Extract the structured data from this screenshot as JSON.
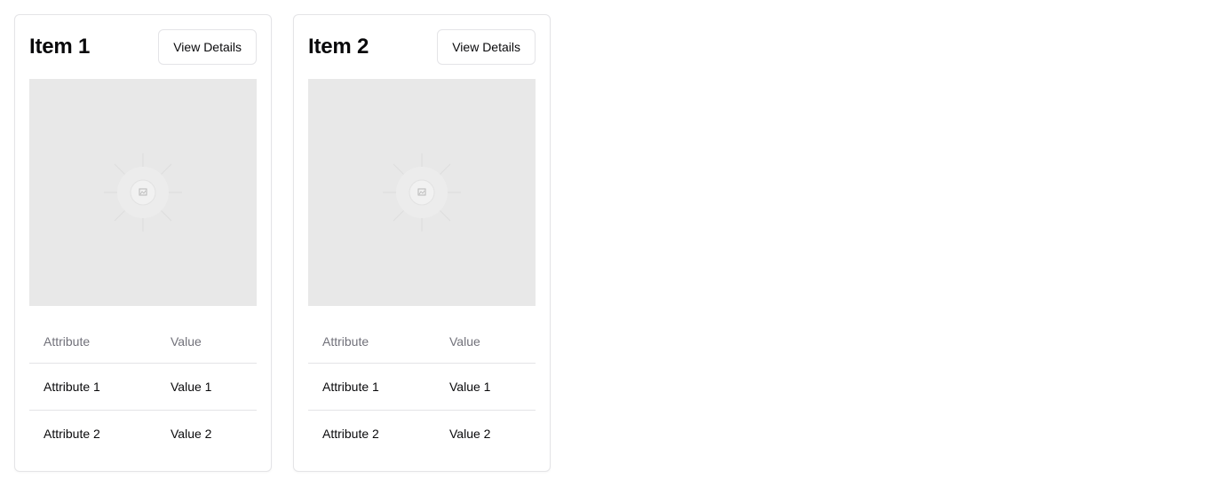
{
  "items": [
    {
      "title": "Item 1",
      "button_label": "View Details",
      "image_icon": "image-placeholder-icon",
      "table": {
        "headers": [
          "Attribute",
          "Value"
        ],
        "rows": [
          [
            "Attribute 1",
            "Value 1"
          ],
          [
            "Attribute 2",
            "Value 2"
          ]
        ]
      }
    },
    {
      "title": "Item 2",
      "button_label": "View Details",
      "image_icon": "image-placeholder-icon",
      "table": {
        "headers": [
          "Attribute",
          "Value"
        ],
        "rows": [
          [
            "Attribute 1",
            "Value 1"
          ],
          [
            "Attribute 2",
            "Value 2"
          ]
        ]
      }
    }
  ],
  "colors": {
    "border": "#e4e4e7",
    "muted_text": "#71717a",
    "image_bg": "#e8e8e8"
  }
}
